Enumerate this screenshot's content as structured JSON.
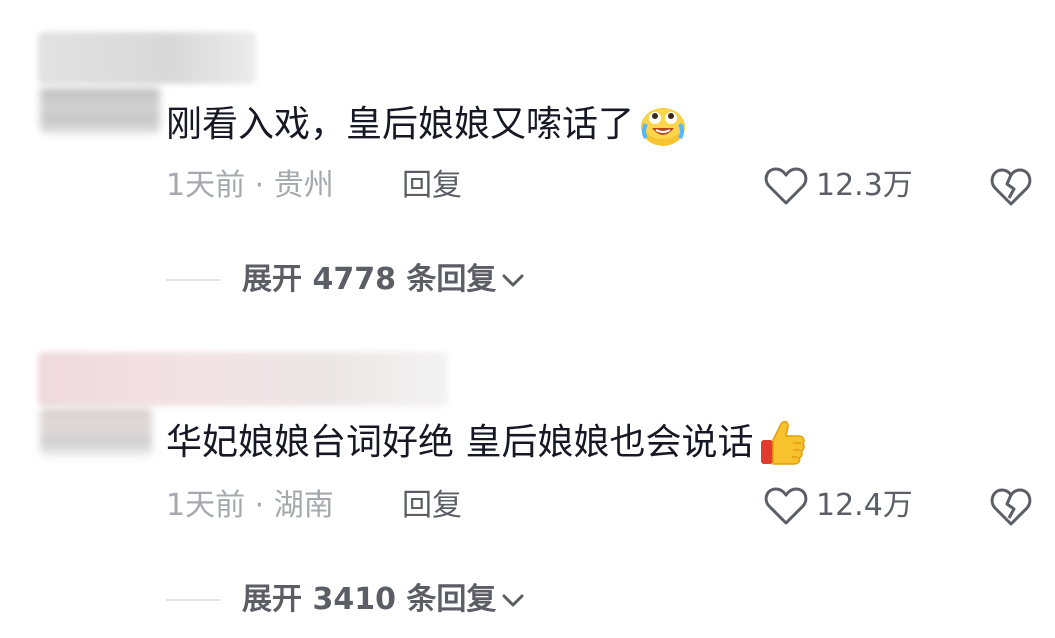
{
  "comments": [
    {
      "text": "刚看入戏，皇后娘娘又嗦话了",
      "emoji": "crying-laughing-emoji",
      "time_location": "1天前 · 贵州",
      "reply_label": "回复",
      "likes": "12.3万",
      "expand_label": "展开 4778 条回复"
    },
    {
      "text": "华妃娘娘台词好绝 皇后娘娘也会说话",
      "emoji": "thumbs-up-emoji",
      "time_location": "1天前 · 湖南",
      "reply_label": "回复",
      "likes": "12.4万",
      "expand_label": "展开 3410 条回复"
    }
  ],
  "icons": {
    "like": "heart-outline-icon",
    "dislike": "broken-heart-icon",
    "expand": "chevron-down-icon"
  },
  "colors": {
    "text_primary": "#161823",
    "text_secondary": "#a6a8ad",
    "text_action": "#5c5e66",
    "divider": "#e3e3e4"
  }
}
